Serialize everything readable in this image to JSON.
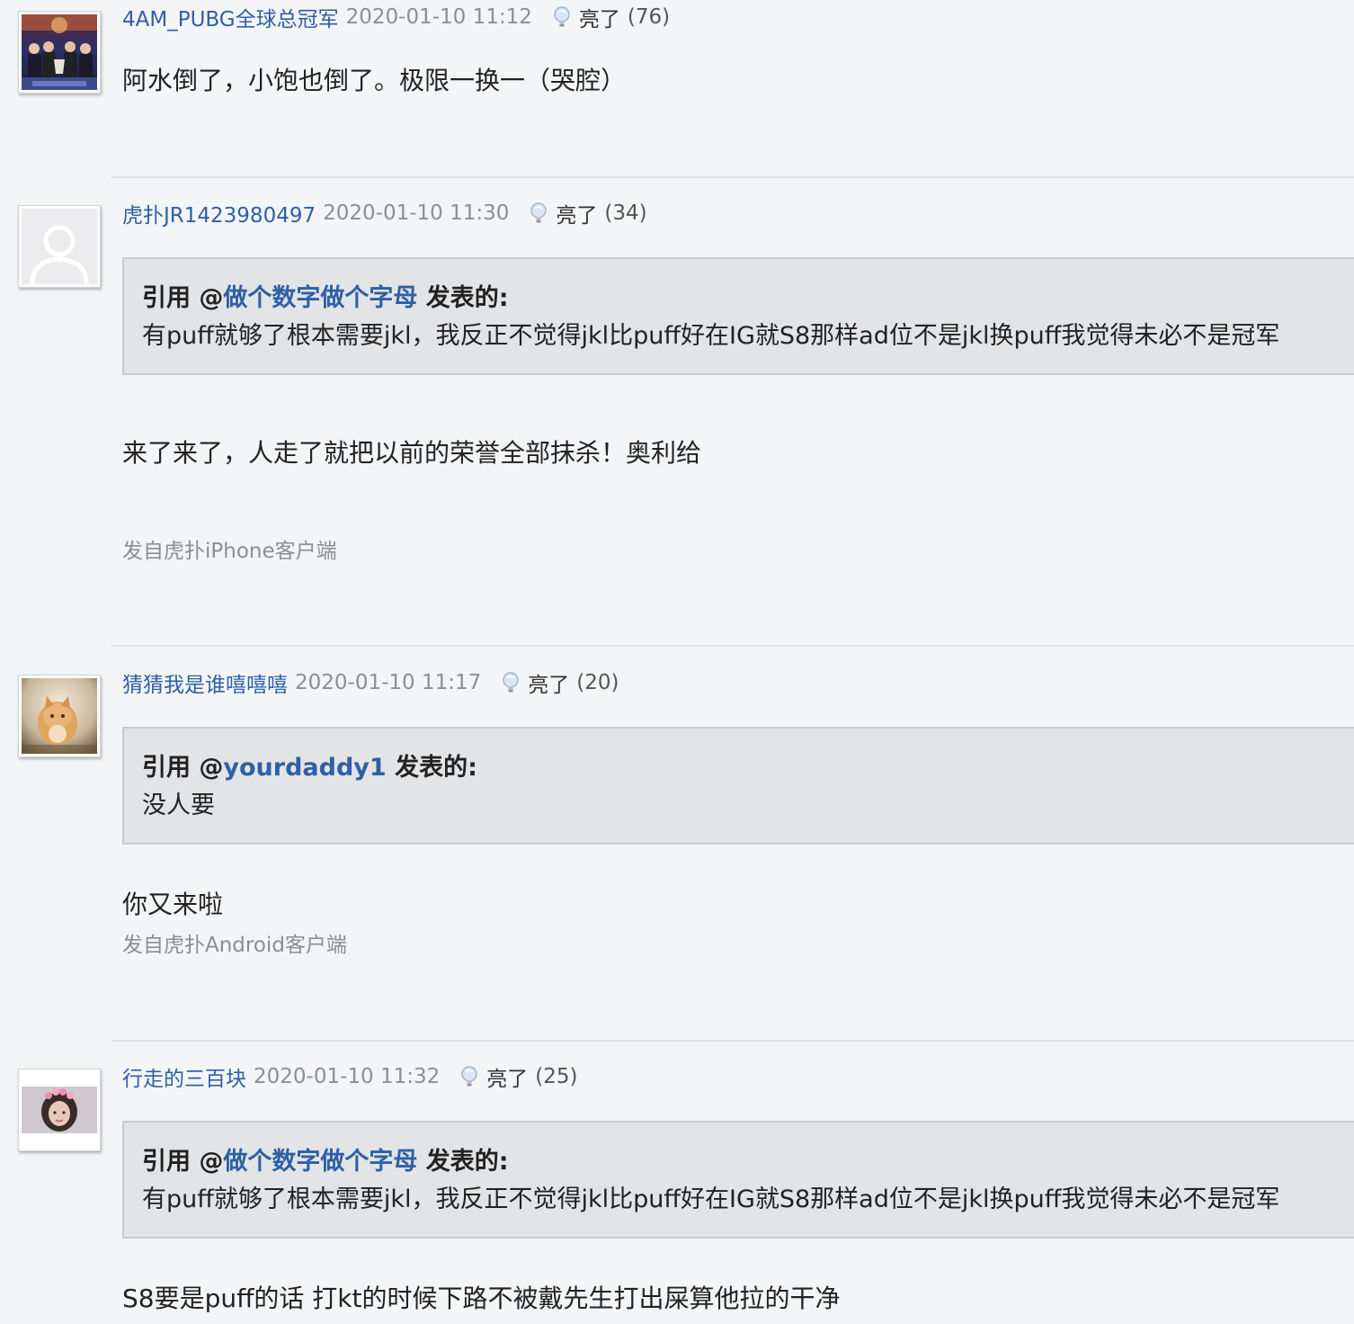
{
  "posts": [
    {
      "username": "4AM_PUBG全球总冠军",
      "time": "2020-01-10 11:12",
      "light_label": "亮了",
      "light_count": "(76)",
      "content": "阿水倒了，小饱也倒了。极限一换一（哭腔）"
    },
    {
      "username": "虎扑JR1423980497",
      "time": "2020-01-10 11:30",
      "light_label": "亮了",
      "light_count": "(34)",
      "quote": {
        "prefix": "引用 @",
        "name": "做个数字做个字母",
        "suffix": " 发表的:",
        "body": "有puff就够了根本需要jkl，我反正不觉得jkl比puff好在IG就S8那样ad位不是jkl换puff我觉得未必不是冠军"
      },
      "content": "来了来了，人走了就把以前的荣誉全部抹杀！奥利给",
      "source": "发自虎扑iPhone客户端"
    },
    {
      "username": "猜猜我是谁嘻嘻嘻",
      "time": "2020-01-10 11:17",
      "light_label": "亮了",
      "light_count": "(20)",
      "quote": {
        "prefix": "引用 @",
        "name": "yourdaddy1",
        "suffix": " 发表的:",
        "body": "没人要"
      },
      "content": "你又来啦",
      "source": "发自虎扑Android客户端"
    },
    {
      "username": "行走的三百块",
      "time": "2020-01-10 11:32",
      "light_label": "亮了",
      "light_count": "(25)",
      "quote": {
        "prefix": "引用 @",
        "name": "做个数字做个字母",
        "suffix": " 发表的:",
        "body": "有puff就够了根本需要jkl，我反正不觉得jkl比puff好在IG就S8那样ad位不是jkl换puff我觉得未必不是冠军"
      },
      "content": "S8要是puff的话 打kt的时候下路不被戴先生打出屎算他拉的干净"
    }
  ],
  "icons": {
    "light": "lightbulb-icon",
    "default_avatar": "user-silhouette-icon"
  },
  "colors": {
    "username": "#2f5fa5",
    "meta_gray": "#8a8f96",
    "quote_bg": "#e3e4e6",
    "page_bg": "#f4f5f7"
  }
}
